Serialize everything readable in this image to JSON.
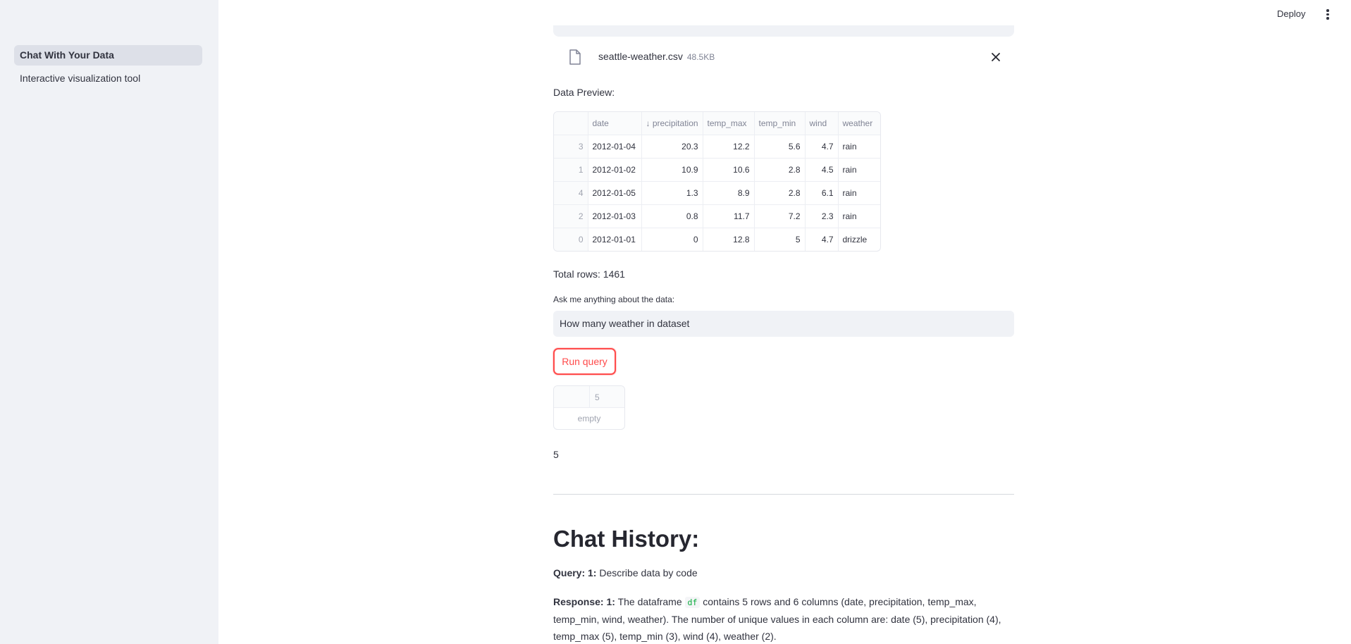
{
  "sidebar": {
    "items": [
      {
        "label": "Chat With Your Data"
      },
      {
        "label": "Interactive visualization tool"
      }
    ]
  },
  "header": {
    "deploy_label": "Deploy"
  },
  "uploader": {
    "file_name": "seattle-weather.csv",
    "file_size": "48.5KB"
  },
  "preview": {
    "label": "Data Preview:",
    "columns": [
      "date",
      "↓ precipitation",
      "temp_max",
      "temp_min",
      "wind",
      "weather"
    ],
    "rows": [
      {
        "idx": "3",
        "cells": [
          "2012-01-04",
          "20.3",
          "12.2",
          "5.6",
          "4.7",
          "rain"
        ]
      },
      {
        "idx": "1",
        "cells": [
          "2012-01-02",
          "10.9",
          "10.6",
          "2.8",
          "4.5",
          "rain"
        ]
      },
      {
        "idx": "4",
        "cells": [
          "2012-01-05",
          "1.3",
          "8.9",
          "2.8",
          "6.1",
          "rain"
        ]
      },
      {
        "idx": "2",
        "cells": [
          "2012-01-03",
          "0.8",
          "11.7",
          "7.2",
          "2.3",
          "rain"
        ]
      },
      {
        "idx": "0",
        "cells": [
          "2012-01-01",
          "0",
          "12.8",
          "5",
          "4.7",
          "drizzle"
        ]
      }
    ]
  },
  "total_rows": "Total rows: 1461",
  "ask": {
    "label": "Ask me anything about the data:",
    "value": "How many weather in dataset"
  },
  "run_button": "Run query",
  "result_df": {
    "column": "5",
    "empty_text": "empty"
  },
  "answer": "5",
  "history": {
    "title": "Chat History:",
    "query_prefix": "Query: 1:",
    "query_text": "Describe data by code",
    "response_prefix": "Response: 1:",
    "response_before_code": "The dataframe",
    "response_code": "df",
    "response_after_code": "contains 5 rows and 6 columns (date, precipitation, temp_max, temp_min, wind, weather). The number of unique values in each column are: date (5), precipitation (4), temp_max (5), temp_min (3), wind (4), weather (2)."
  }
}
